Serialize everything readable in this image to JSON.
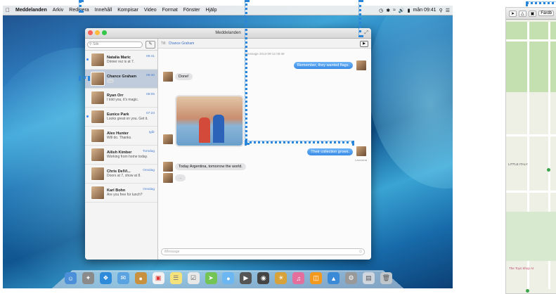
{
  "menubar": {
    "app_name": "Meddelanden",
    "items": [
      "Arkiv",
      "Redigera",
      "Innehåll",
      "Kompisar",
      "Video",
      "Format",
      "Fönster",
      "Hjälp"
    ],
    "clock": "mån 09:41"
  },
  "window": {
    "title": "Meddelanden",
    "search_placeholder": "Sök",
    "to_label": "Till:",
    "to_name": "Chance Graham",
    "timestamp": "iMessage 2013-09-12 09:39",
    "input_placeholder": "iMessage"
  },
  "conversations": [
    {
      "name": "Natalia Maric",
      "snippet": "Dinner rez is at 7.",
      "time": "09:41",
      "unread": true
    },
    {
      "name": "Chance Graham",
      "snippet": "",
      "time": "09:40",
      "selected": true,
      "typing": "..."
    },
    {
      "name": "Ryan Orr",
      "snippet": "I told you, it's magic.",
      "time": "08:05"
    },
    {
      "name": "Eunice Park",
      "snippet": "Looks great on you. Get it.",
      "time": "07:23",
      "unread": true
    },
    {
      "name": "Alex Hunter",
      "snippet": "Will do. Thanks.",
      "time": "Igår"
    },
    {
      "name": "Ailish Kimber",
      "snippet": "Working from home today.",
      "time": "Torsdag"
    },
    {
      "name": "Chris DelVi...",
      "snippet": "Doors at 7, show at 8.",
      "time": "Onsdag"
    },
    {
      "name": "Karl Bohn",
      "snippet": "Are you free for lunch?",
      "time": "Onsdag"
    }
  ],
  "messages": {
    "m1": "Remember, they wanted flags.",
    "m2": "Done!",
    "m3": "Their collection grows.",
    "delivered": "Levererat",
    "m4": "Today Argentina, tomorrow the world.",
    "typing": "..."
  },
  "map": {
    "toolbar_label": "Färdb",
    "labels": [
      "LITTLE ITALY",
      "The Toys Shop At"
    ]
  },
  "colors": {
    "accent": "#3a8be6",
    "guide": "#2b85d8"
  }
}
